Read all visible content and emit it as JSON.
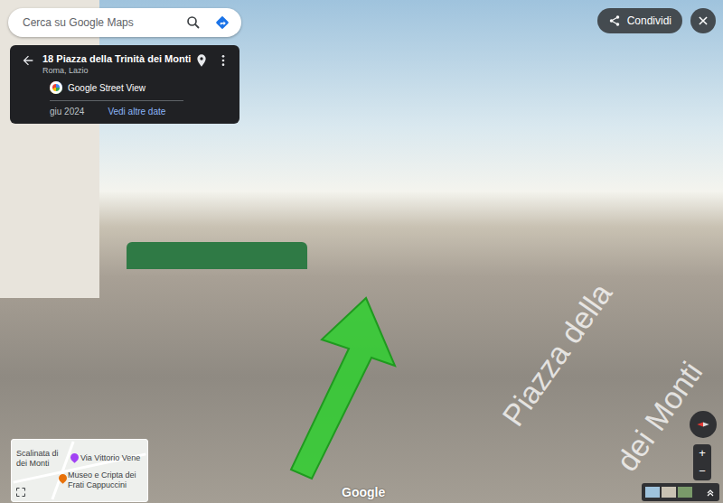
{
  "search": {
    "placeholder": "Cerca su Google Maps"
  },
  "place_card": {
    "title": "18 Piazza della Trinità dei Monti",
    "subtitle": "Roma, Lazio",
    "source": "Google Street View",
    "date": "giu 2024",
    "more_dates": "Vedi altre date"
  },
  "share_button": {
    "label": "Condividi"
  },
  "road_label": [
    "Piazza della",
    "dei Monti"
  ],
  "minimap": {
    "labels": [
      "Scalinata di",
      "dei Monti",
      "Via Vittorio Vene",
      "Museo e Cripta dei",
      "Frati Cappuccini"
    ]
  },
  "zoom": [
    "+",
    "−"
  ],
  "watermark": "Google"
}
